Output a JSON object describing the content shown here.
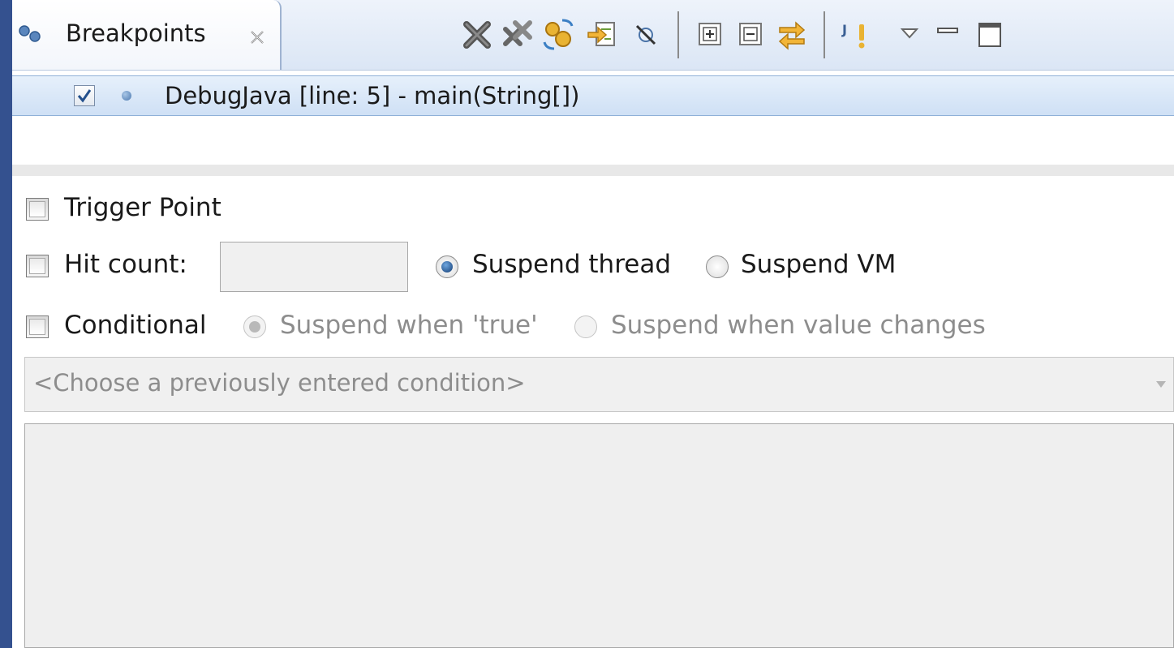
{
  "tab": {
    "title": "Breakpoints"
  },
  "toolbar": {
    "buttons": [
      "remove-selected-icon",
      "remove-all-icon",
      "show-supported-breakpoints-icon",
      "go-to-file-icon",
      "skip-all-breakpoints-icon",
      "expand-all-icon",
      "collapse-all-icon",
      "link-with-debug-view-icon",
      "add-java-exception-breakpoint-icon",
      "view-menu-icon",
      "minimize-icon",
      "maximize-icon"
    ]
  },
  "breakpoints": [
    {
      "label": "DebugJava [line: 5] - main(String[])",
      "enabled": true
    }
  ],
  "detail": {
    "trigger_point": "Trigger Point",
    "hit_count_label": "Hit count:",
    "hit_count_value": "",
    "suspend_thread": "Suspend thread",
    "suspend_vm": "Suspend VM",
    "conditional": "Conditional",
    "suspend_when_true": "Suspend when 'true'",
    "suspend_when_changes": "Suspend when value changes",
    "condition_placeholder": "<Choose a previously entered condition>",
    "condition_text": ""
  },
  "colors": {
    "window_frame": "#34518f",
    "selected_row": "#cfe0f5",
    "tab_bar": "#dbe6f5"
  }
}
